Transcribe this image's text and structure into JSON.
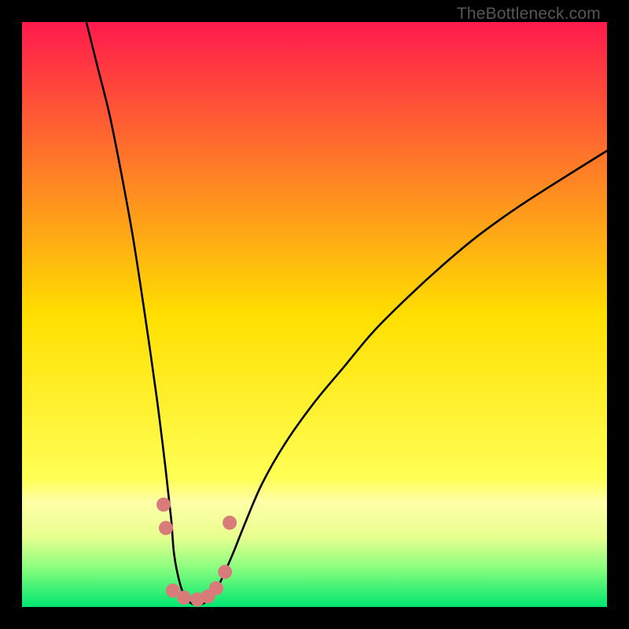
{
  "watermark": "TheBottleneck.com",
  "chart_data": {
    "type": "line",
    "title": "",
    "xlabel": "",
    "ylabel": "",
    "xlim": [
      0,
      100
    ],
    "ylim": [
      0,
      100
    ],
    "grid": false,
    "x": [
      11,
      13,
      15,
      17,
      19,
      21,
      23,
      24.5,
      25.5,
      26,
      27,
      28,
      29,
      30,
      31,
      32.5,
      34,
      36,
      38,
      41,
      45,
      50,
      55,
      60,
      66,
      72,
      78,
      85,
      92,
      100
    ],
    "values": [
      100,
      92,
      84,
      74,
      63,
      50,
      36,
      24,
      15,
      9,
      4,
      1.5,
      0.6,
      0.4,
      0.6,
      1.8,
      4.5,
      9,
      14,
      21,
      28,
      35,
      41,
      47,
      53,
      58.5,
      63.5,
      68.5,
      73,
      78
    ],
    "markers": [
      {
        "x": 24.2,
        "y": 17.5
      },
      {
        "x": 24.6,
        "y": 13.5
      },
      {
        "x": 25.8,
        "y": 2.8
      },
      {
        "x": 27.7,
        "y": 1.6
      },
      {
        "x": 30.0,
        "y": 1.3
      },
      {
        "x": 31.8,
        "y": 1.8
      },
      {
        "x": 33.2,
        "y": 3.2
      },
      {
        "x": 34.7,
        "y": 6.0
      },
      {
        "x": 35.5,
        "y": 14.4
      }
    ],
    "marker_style": {
      "color": "#d97b7b",
      "radius_px": 9
    },
    "gradient_stops": [
      {
        "offset": 0.0,
        "color": "#ff1a4d"
      },
      {
        "offset": 0.5,
        "color": "#ffdf00"
      },
      {
        "offset": 0.78,
        "color": "#ffff55"
      },
      {
        "offset": 0.82,
        "color": "#ffffa8"
      },
      {
        "offset": 0.88,
        "color": "#e8ff90"
      },
      {
        "offset": 0.93,
        "color": "#90ff80"
      },
      {
        "offset": 1.0,
        "color": "#00e670"
      }
    ]
  }
}
